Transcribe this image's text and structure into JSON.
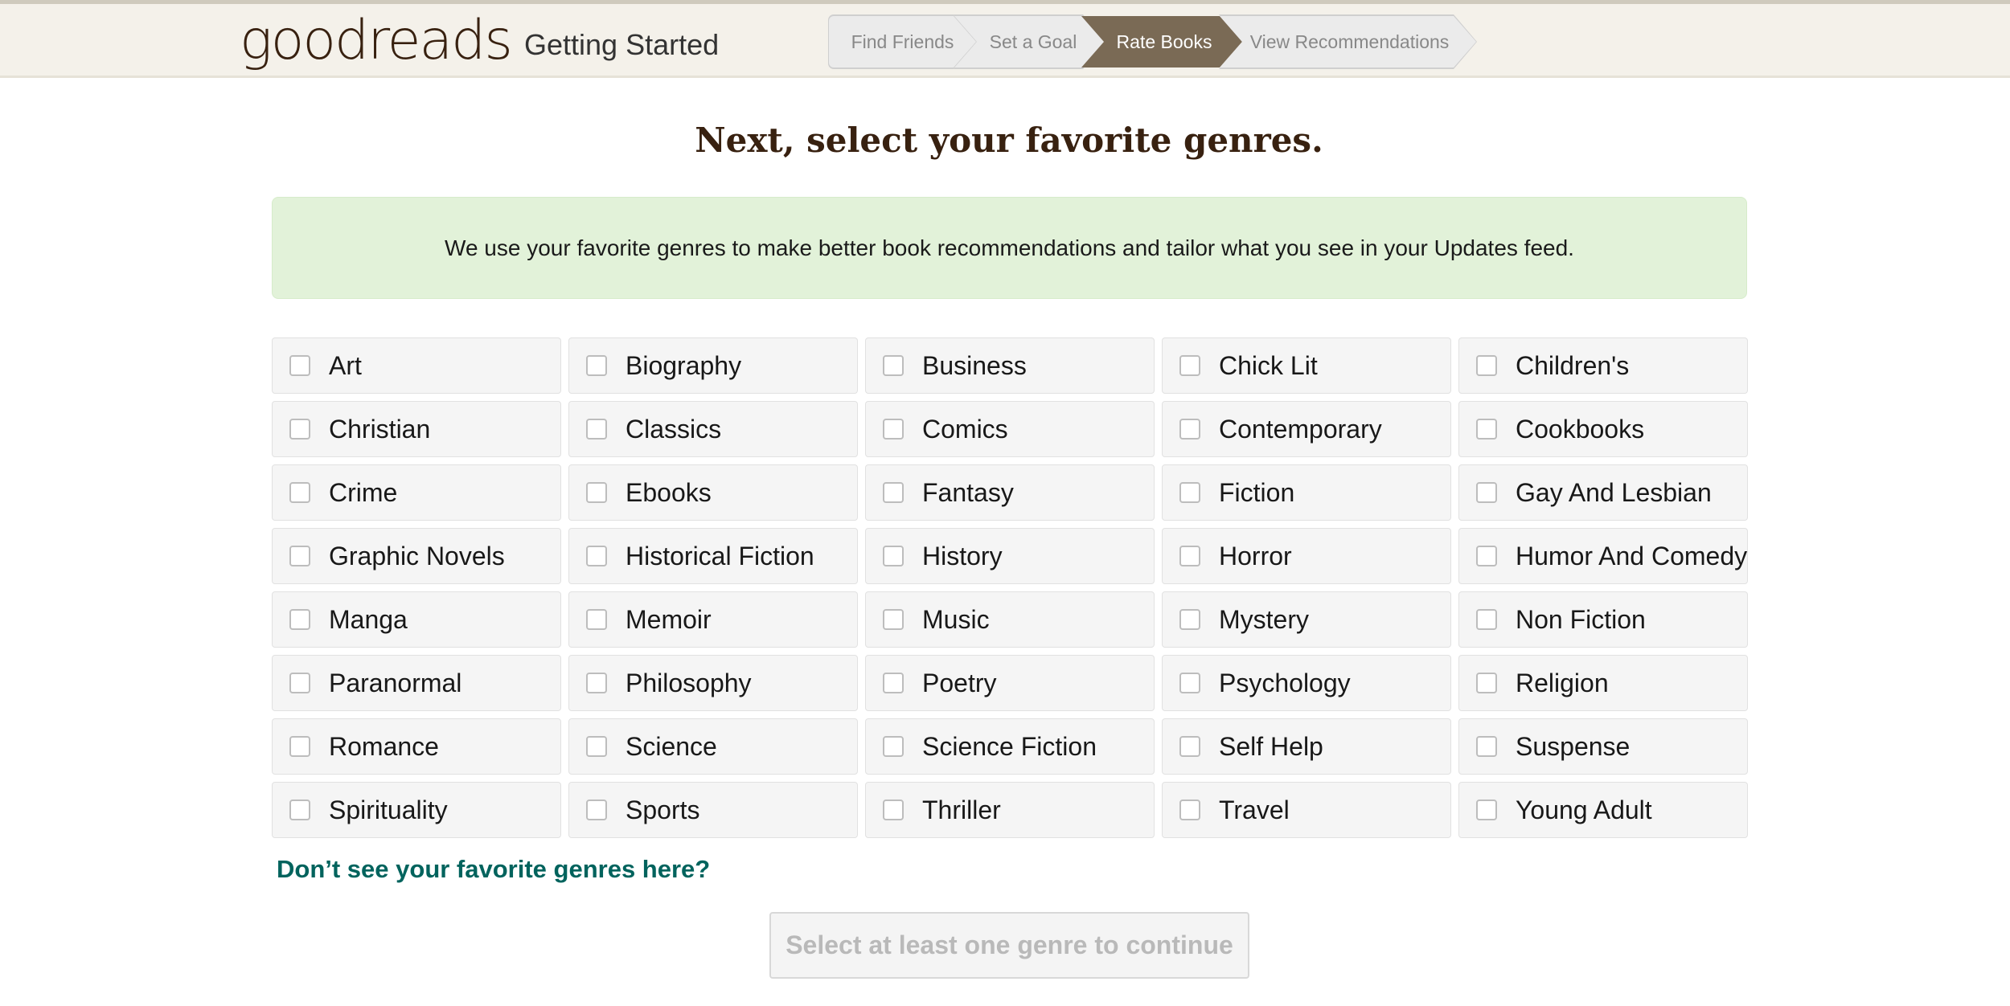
{
  "header": {
    "logo": {
      "part1": "good",
      "part2": "reads"
    },
    "title": "Getting Started",
    "steps": [
      {
        "label": "Find Friends",
        "active": false
      },
      {
        "label": "Set a Goal",
        "active": false
      },
      {
        "label": "Rate Books",
        "active": true
      },
      {
        "label": "View Recommendations",
        "active": false
      }
    ]
  },
  "main": {
    "headline": "Next, select your favorite genres.",
    "info": "We use your favorite genres to make better book recommendations and tailor what you see in your Updates feed.",
    "genres": [
      "Art",
      "Biography",
      "Business",
      "Chick Lit",
      "Children's",
      "Christian",
      "Classics",
      "Comics",
      "Contemporary",
      "Cookbooks",
      "Crime",
      "Ebooks",
      "Fantasy",
      "Fiction",
      "Gay And Lesbian",
      "Graphic Novels",
      "Historical Fiction",
      "History",
      "Horror",
      "Humor And Comedy",
      "Manga",
      "Memoir",
      "Music",
      "Mystery",
      "Non Fiction",
      "Paranormal",
      "Philosophy",
      "Poetry",
      "Psychology",
      "Religion",
      "Romance",
      "Science",
      "Science Fiction",
      "Self Help",
      "Suspense",
      "Spirituality",
      "Sports",
      "Thriller",
      "Travel",
      "Young Adult"
    ],
    "more_link": "Don’t see your favorite genres here?",
    "continue_button": "Select at least one genre to continue"
  },
  "colors": {
    "header_bg": "#f4f1ea",
    "brand_brown": "#382110",
    "active_step": "#7a6a55",
    "info_bg": "#e2f2d9",
    "link": "#00635d"
  }
}
